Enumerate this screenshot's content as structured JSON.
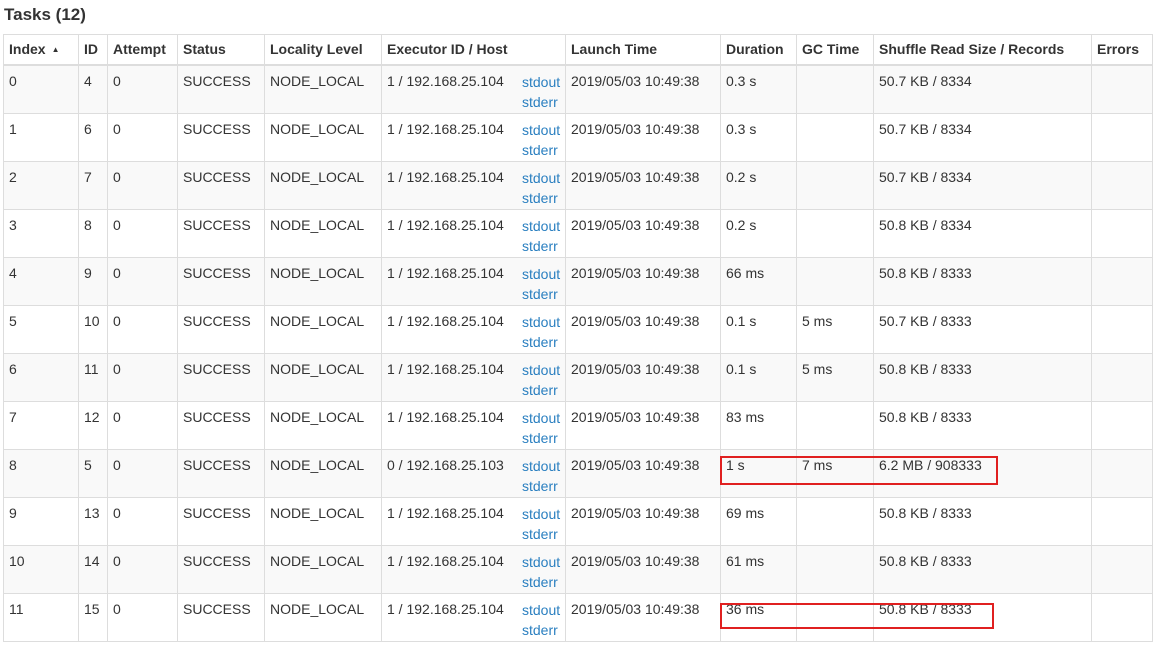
{
  "page": {
    "title": "Tasks (12)"
  },
  "table": {
    "columns": [
      {
        "key": "index",
        "label": "Index",
        "sorted": "asc"
      },
      {
        "key": "id",
        "label": "ID"
      },
      {
        "key": "attempt",
        "label": "Attempt"
      },
      {
        "key": "status",
        "label": "Status"
      },
      {
        "key": "locality",
        "label": "Locality Level"
      },
      {
        "key": "executor",
        "label": "Executor ID / Host"
      },
      {
        "key": "launch",
        "label": "Launch Time"
      },
      {
        "key": "duration",
        "label": "Duration"
      },
      {
        "key": "gc",
        "label": "GC Time"
      },
      {
        "key": "shuffle",
        "label": "Shuffle Read Size / Records"
      },
      {
        "key": "errors",
        "label": "Errors"
      }
    ],
    "sort_arrow": "▲",
    "log_links": {
      "stdout": "stdout",
      "stderr": "stderr"
    },
    "rows": [
      {
        "index": "0",
        "id": "4",
        "attempt": "0",
        "status": "SUCCESS",
        "locality": "NODE_LOCAL",
        "executor": "1 / 192.168.25.104",
        "launch": "2019/05/03 10:49:38",
        "duration": "0.3 s",
        "gc": "",
        "shuffle": "50.7 KB / 8334",
        "errors": ""
      },
      {
        "index": "1",
        "id": "6",
        "attempt": "0",
        "status": "SUCCESS",
        "locality": "NODE_LOCAL",
        "executor": "1 / 192.168.25.104",
        "launch": "2019/05/03 10:49:38",
        "duration": "0.3 s",
        "gc": "",
        "shuffle": "50.7 KB / 8334",
        "errors": ""
      },
      {
        "index": "2",
        "id": "7",
        "attempt": "0",
        "status": "SUCCESS",
        "locality": "NODE_LOCAL",
        "executor": "1 / 192.168.25.104",
        "launch": "2019/05/03 10:49:38",
        "duration": "0.2 s",
        "gc": "",
        "shuffle": "50.7 KB / 8334",
        "errors": ""
      },
      {
        "index": "3",
        "id": "8",
        "attempt": "0",
        "status": "SUCCESS",
        "locality": "NODE_LOCAL",
        "executor": "1 / 192.168.25.104",
        "launch": "2019/05/03 10:49:38",
        "duration": "0.2 s",
        "gc": "",
        "shuffle": "50.8 KB / 8334",
        "errors": ""
      },
      {
        "index": "4",
        "id": "9",
        "attempt": "0",
        "status": "SUCCESS",
        "locality": "NODE_LOCAL",
        "executor": "1 / 192.168.25.104",
        "launch": "2019/05/03 10:49:38",
        "duration": "66 ms",
        "gc": "",
        "shuffle": "50.8 KB / 8333",
        "errors": ""
      },
      {
        "index": "5",
        "id": "10",
        "attempt": "0",
        "status": "SUCCESS",
        "locality": "NODE_LOCAL",
        "executor": "1 / 192.168.25.104",
        "launch": "2019/05/03 10:49:38",
        "duration": "0.1 s",
        "gc": "5 ms",
        "shuffle": "50.7 KB / 8333",
        "errors": ""
      },
      {
        "index": "6",
        "id": "11",
        "attempt": "0",
        "status": "SUCCESS",
        "locality": "NODE_LOCAL",
        "executor": "1 / 192.168.25.104",
        "launch": "2019/05/03 10:49:38",
        "duration": "0.1 s",
        "gc": "5 ms",
        "shuffle": "50.8 KB / 8333",
        "errors": ""
      },
      {
        "index": "7",
        "id": "12",
        "attempt": "0",
        "status": "SUCCESS",
        "locality": "NODE_LOCAL",
        "executor": "1 / 192.168.25.104",
        "launch": "2019/05/03 10:49:38",
        "duration": "83 ms",
        "gc": "",
        "shuffle": "50.8 KB / 8333",
        "errors": ""
      },
      {
        "index": "8",
        "id": "5",
        "attempt": "0",
        "status": "SUCCESS",
        "locality": "NODE_LOCAL",
        "executor": "0 / 192.168.25.103",
        "launch": "2019/05/03 10:49:38",
        "duration": "1 s",
        "gc": "7 ms",
        "shuffle": "6.2 MB / 908333",
        "errors": ""
      },
      {
        "index": "9",
        "id": "13",
        "attempt": "0",
        "status": "SUCCESS",
        "locality": "NODE_LOCAL",
        "executor": "1 / 192.168.25.104",
        "launch": "2019/05/03 10:49:38",
        "duration": "69 ms",
        "gc": "",
        "shuffle": "50.8 KB / 8333",
        "errors": ""
      },
      {
        "index": "10",
        "id": "14",
        "attempt": "0",
        "status": "SUCCESS",
        "locality": "NODE_LOCAL",
        "executor": "1 / 192.168.25.104",
        "launch": "2019/05/03 10:49:38",
        "duration": "61 ms",
        "gc": "",
        "shuffle": "50.8 KB / 8333",
        "errors": ""
      },
      {
        "index": "11",
        "id": "15",
        "attempt": "0",
        "status": "SUCCESS",
        "locality": "NODE_LOCAL",
        "executor": "1 / 192.168.25.104",
        "launch": "2019/05/03 10:49:38",
        "duration": "36 ms",
        "gc": "",
        "shuffle": "50.8 KB / 8333",
        "errors": ""
      }
    ]
  },
  "colors": {
    "link": "#2a7fc0",
    "highlight": "#e02020",
    "row_stripe": "#f9f9f9",
    "border": "#dddddd"
  }
}
